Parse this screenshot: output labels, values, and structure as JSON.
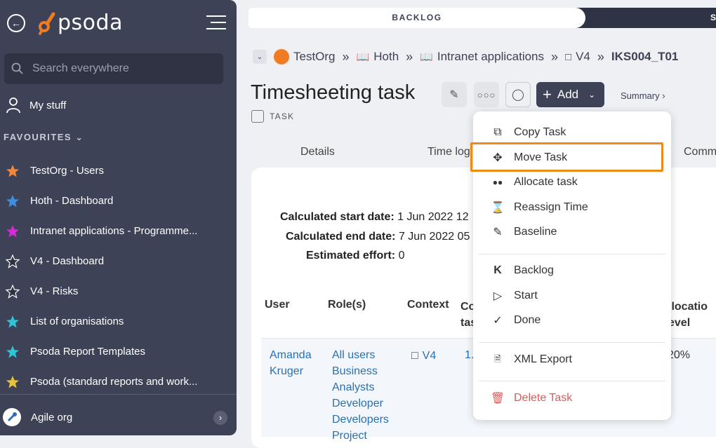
{
  "sidebar": {
    "brand": "psoda",
    "search_placeholder": "Search everywhere",
    "my_stuff": "My stuff",
    "favourites_heading": "FAVOURITES",
    "favourites": [
      {
        "label": "TestOrg - Users",
        "color": "#f3863a"
      },
      {
        "label": "Hoth - Dashboard",
        "color": "#3f8ee0"
      },
      {
        "label": "Intranet applications - Programme...",
        "color": "#d52bd6"
      },
      {
        "label": "V4 - Dashboard",
        "color": "#2e3140"
      },
      {
        "label": "V4 - Risks",
        "color": "#2e3140"
      },
      {
        "label": "List of organisations",
        "color": "#2ec4d6"
      },
      {
        "label": "Psoda Report Templates",
        "color": "#2ec4d6"
      },
      {
        "label": "Psoda (standard reports and work...",
        "color": "#e8c23a"
      }
    ],
    "org": "Agile org"
  },
  "top_tabs": {
    "backlog": "BACKLOG",
    "next": "S"
  },
  "breadcrumb": {
    "items": [
      "TestOrg",
      "Hoth",
      "Intranet applications",
      "V4",
      "IKS004_T01"
    ]
  },
  "page": {
    "title": "Timesheeting task",
    "type_label": "TASK",
    "add_label": "Add",
    "summary_label": "Summary ›"
  },
  "tabs": [
    "Details",
    "Time log",
    "Comm"
  ],
  "info": {
    "start_label": "Calculated start date:",
    "start_value": "1 Jun 2022 12",
    "end_label": "Calculated end date:",
    "end_value": "7 Jun 2022 05",
    "effort_label": "Estimated effort:",
    "effort_value": "0"
  },
  "table": {
    "headers": [
      "User",
      "Role(s)",
      "Context",
      "Co\ntas",
      "llocatio\nevel"
    ],
    "row": {
      "user": "Amanda\nKruger",
      "roles": "All users\nBusiness\nAnalysts\nDeveloper\nDevelopers\nProject",
      "context": "V4",
      "col4": "1.",
      "allocation": "20%"
    }
  },
  "menu": {
    "items": [
      {
        "label": "Copy Task",
        "icon": "copy-icon"
      },
      {
        "label": "Move Task",
        "icon": "move-icon"
      },
      {
        "label": "Allocate task",
        "icon": "people-icon"
      },
      {
        "label": "Reassign Time",
        "icon": "reassign-time-icon"
      },
      {
        "label": "Baseline",
        "icon": "pencil-icon"
      },
      {
        "label": "Backlog",
        "icon": "backlog-icon"
      },
      {
        "label": "Start",
        "icon": "play-icon"
      },
      {
        "label": "Done",
        "icon": "done-icon"
      },
      {
        "label": "XML Export",
        "icon": "xml-icon"
      },
      {
        "label": "Delete Task",
        "icon": "trash-icon"
      }
    ],
    "highlight_color": "#f08a16",
    "danger_color": "#e05a55"
  }
}
